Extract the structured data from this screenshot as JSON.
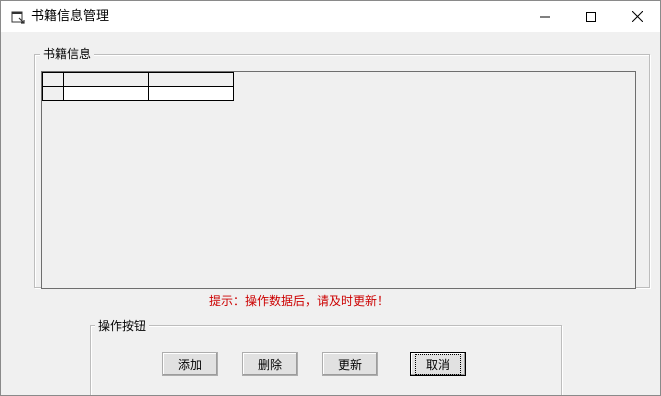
{
  "window": {
    "title": "书籍信息管理",
    "icons": {
      "app": "window-app-icon",
      "minimize": "minimize-icon",
      "maximize": "maximize-icon",
      "close": "close-icon"
    }
  },
  "books_group": {
    "legend": "书籍信息",
    "grid": {
      "columns": [
        "",
        ""
      ],
      "rows": [
        [
          "",
          ""
        ]
      ]
    }
  },
  "tip": "提示：操作数据后，请及时更新！",
  "actions_group": {
    "legend": "操作按钮",
    "buttons": {
      "add": "添加",
      "delete": "删除",
      "update": "更新",
      "cancel": "取消"
    }
  },
  "colors": {
    "tip": "#cc0000",
    "window_bg": "#f0f0f0"
  }
}
